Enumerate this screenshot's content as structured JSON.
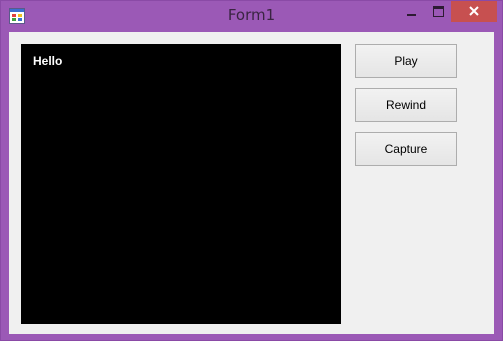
{
  "window": {
    "title": "Form1",
    "icon": "form-app-icon",
    "controls": [
      "minimize-icon",
      "maximize-icon",
      "close-icon"
    ]
  },
  "video": {
    "overlay_text": "Hello"
  },
  "buttons": {
    "play": "Play",
    "rewind": "Rewind",
    "capture": "Capture"
  },
  "colors": {
    "frame": "#9b59b6",
    "close_button": "#c75050",
    "client_background": "#f0f0f0",
    "video_background": "#000000"
  }
}
